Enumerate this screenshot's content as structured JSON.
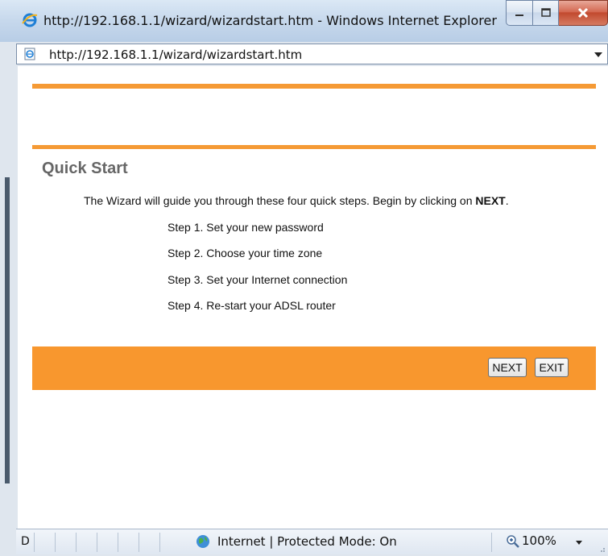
{
  "window": {
    "title": "http://192.168.1.1/wizard/wizardstart.htm - Windows Internet Explorer",
    "address": "http://192.168.1.1/wizard/wizardstart.htm"
  },
  "page": {
    "heading": "Quick Start",
    "intro_text": "The Wizard will guide you through these four quick steps. Begin by clicking on ",
    "intro_emphasis": "NEXT",
    "intro_end": ".",
    "steps": [
      "Step 1. Set your new password",
      "Step 2. Choose your time zone",
      "Step 3. Set your Internet connection",
      "Step 4. Re-start your ADSL router"
    ],
    "next_label": "NEXT",
    "exit_label": "EXIT"
  },
  "status": {
    "left_text": "D",
    "zone": "Internet | Protected Mode: On",
    "zoom": "100%"
  },
  "colors": {
    "accent": "#f59a35",
    "panel": "#f8972e",
    "heading": "#666666"
  },
  "icons": [
    "ie-logo-icon",
    "page-icon",
    "minimize-icon",
    "maximize-icon",
    "close-icon",
    "dropdown-icon",
    "globe-icon",
    "zoom-icon"
  ]
}
